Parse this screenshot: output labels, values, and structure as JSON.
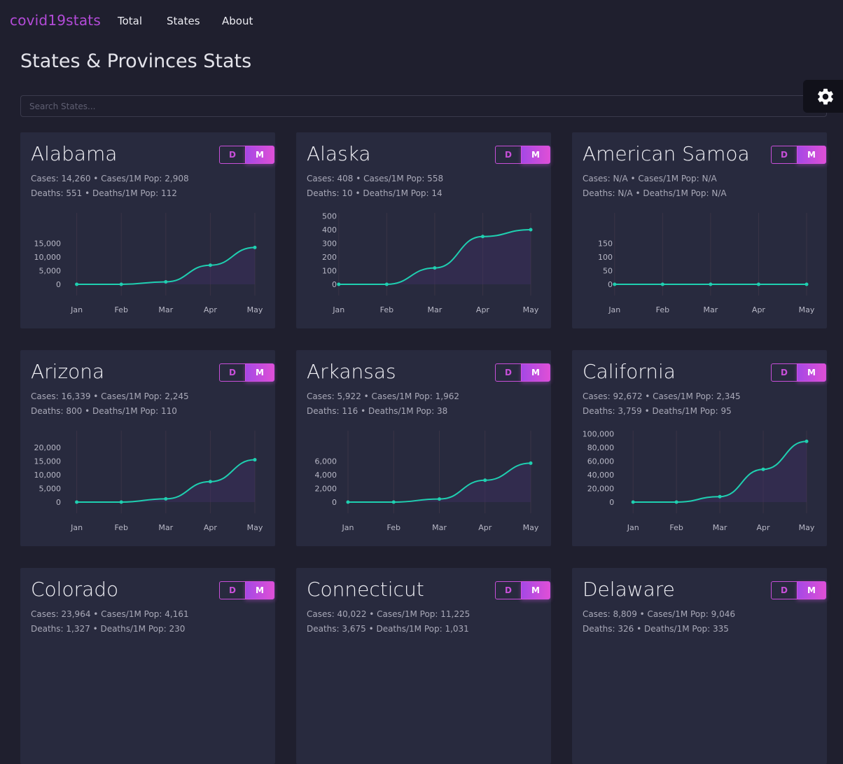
{
  "nav": {
    "brand": "covid19stats",
    "links": [
      "Total",
      "States",
      "About"
    ]
  },
  "page": {
    "title": "States & Provinces Stats",
    "search_placeholder": "Search States..."
  },
  "settings": {
    "icon": "gear-icon"
  },
  "colors": {
    "accent": "#c74fd9",
    "line": "#1fcfb0",
    "card_bg": "#282a3e",
    "page_bg": "#1f1f2e"
  },
  "cards": [
    {
      "name": "Alabama",
      "toggle": {
        "d": "D",
        "m": "M",
        "selected": "M"
      },
      "stats1": "Cases: 14,260 • Cases/1M Pop: 2,908",
      "stats2": "Deaths: 551 • Deaths/1M Pop: 112",
      "chart_data": {
        "type": "line",
        "categories": [
          "Jan",
          "Feb",
          "Mar",
          "Apr",
          "May"
        ],
        "values": [
          0,
          0,
          900,
          7000,
          13500
        ],
        "yticks": [
          0,
          5000,
          10000,
          15000
        ],
        "ytick_labels": [
          "0",
          "5,000",
          "10,000",
          "15,000"
        ],
        "ylim": [
          0,
          15000
        ]
      }
    },
    {
      "name": "Alaska",
      "toggle": {
        "d": "D",
        "m": "M",
        "selected": "M"
      },
      "stats1": "Cases: 408 • Cases/1M Pop: 558",
      "stats2": "Deaths: 10 • Deaths/1M Pop: 14",
      "chart_data": {
        "type": "line",
        "categories": [
          "Jan",
          "Feb",
          "Mar",
          "Apr",
          "May"
        ],
        "values": [
          0,
          0,
          120,
          350,
          400
        ],
        "yticks": [
          0,
          100,
          200,
          300,
          400,
          500
        ],
        "ytick_labels": [
          "0",
          "100",
          "200",
          "300",
          "400",
          "500"
        ],
        "ylim": [
          0,
          500
        ]
      }
    },
    {
      "name": "American Samoa",
      "toggle": {
        "d": "D",
        "m": "M",
        "selected": "M"
      },
      "stats1": "Cases: N/A • Cases/1M Pop: N/A",
      "stats2": "Deaths: N/A • Deaths/1M Pop: N/A",
      "chart_data": {
        "type": "line",
        "categories": [
          "Jan",
          "Feb",
          "Mar",
          "Apr",
          "May"
        ],
        "values": [
          0,
          0,
          0,
          0,
          0
        ],
        "yticks": [
          0,
          50,
          100,
          150
        ],
        "ytick_labels": [
          "0",
          "50",
          "100",
          "150"
        ],
        "ylim": [
          0,
          150
        ]
      }
    },
    {
      "name": "Arizona",
      "toggle": {
        "d": "D",
        "m": "M",
        "selected": "M"
      },
      "stats1": "Cases: 16,339 • Cases/1M Pop: 2,245",
      "stats2": "Deaths: 800 • Deaths/1M Pop: 110",
      "chart_data": {
        "type": "line",
        "categories": [
          "Jan",
          "Feb",
          "Mar",
          "Apr",
          "May"
        ],
        "values": [
          0,
          0,
          1200,
          7500,
          15500
        ],
        "yticks": [
          0,
          5000,
          10000,
          15000,
          20000
        ],
        "ytick_labels": [
          "0",
          "5,000",
          "10,000",
          "15,000",
          "20,000"
        ],
        "ylim": [
          0,
          20000
        ]
      }
    },
    {
      "name": "Arkansas",
      "toggle": {
        "d": "D",
        "m": "M",
        "selected": "M"
      },
      "stats1": "Cases: 5,922 • Cases/1M Pop: 1,962",
      "stats2": "Deaths: 116 • Deaths/1M Pop: 38",
      "chart_data": {
        "type": "line",
        "categories": [
          "Jan",
          "Feb",
          "Mar",
          "Apr",
          "May"
        ],
        "values": [
          0,
          0,
          450,
          3200,
          5700
        ],
        "yticks": [
          0,
          2000,
          4000,
          6000
        ],
        "ytick_labels": [
          "0",
          "2,000",
          "4,000",
          "6,000"
        ],
        "ylim": [
          0,
          6000
        ]
      }
    },
    {
      "name": "California",
      "toggle": {
        "d": "D",
        "m": "M",
        "selected": "M"
      },
      "stats1": "Cases: 92,672 • Cases/1M Pop: 2,345",
      "stats2": "Deaths: 3,759 • Deaths/1M Pop: 95",
      "chart_data": {
        "type": "line",
        "categories": [
          "Jan",
          "Feb",
          "Mar",
          "Apr",
          "May"
        ],
        "values": [
          0,
          0,
          8000,
          48000,
          89000
        ],
        "yticks": [
          0,
          20000,
          40000,
          60000,
          80000,
          100000
        ],
        "ytick_labels": [
          "0",
          "20,000",
          "40,000",
          "60,000",
          "80,000",
          "100,000"
        ],
        "ylim": [
          0,
          100000
        ]
      }
    },
    {
      "name": "Colorado",
      "toggle": {
        "d": "D",
        "m": "M",
        "selected": "M"
      },
      "stats1": "Cases: 23,964 • Cases/1M Pop: 4,161",
      "stats2": "Deaths: 1,327 • Deaths/1M Pop: 230"
    },
    {
      "name": "Connecticut",
      "toggle": {
        "d": "D",
        "m": "M",
        "selected": "M"
      },
      "stats1": "Cases: 40,022 • Cases/1M Pop: 11,225",
      "stats2": "Deaths: 3,675 • Deaths/1M Pop: 1,031"
    },
    {
      "name": "Delaware",
      "toggle": {
        "d": "D",
        "m": "M",
        "selected": "M"
      },
      "stats1": "Cases: 8,809 • Cases/1M Pop: 9,046",
      "stats2": "Deaths: 326 • Deaths/1M Pop: 335"
    }
  ]
}
